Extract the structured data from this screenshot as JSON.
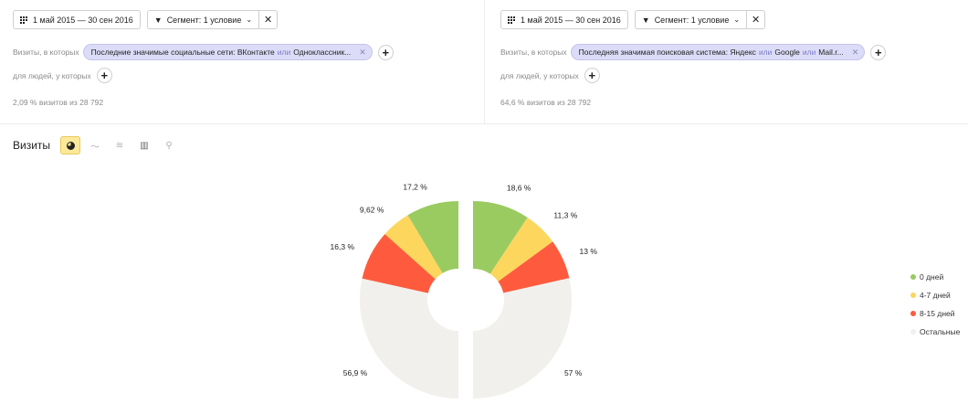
{
  "left": {
    "date_range": "1 май 2015 — 30 сен 2016",
    "segment_label": "Сегмент: 1 условие",
    "visits_label": "Визиты, в которых",
    "chip_text": "Последние значимые социальные сети: ВКонтакте",
    "chip_or": "или",
    "chip_text2": "Одноклассник...",
    "people_label": "для людей, у которых",
    "stat": "2,09 % визитов из 28 792"
  },
  "right": {
    "date_range": "1 май 2015 — 30 сен 2016",
    "segment_label": "Сегмент: 1 условие",
    "visits_label": "Визиты, в которых",
    "chip_text": "Последняя значимая поисковая система: Яндекс",
    "chip_or": "или",
    "chip_text2": "Google",
    "chip_or2": "или",
    "chip_text3": "Mail.r...",
    "people_label": "для людей, у которых",
    "stat": "64,6 % визитов из 28 792"
  },
  "section_title": "Визиты",
  "view_tabs": [
    "pie-chart-icon",
    "line-chart-icon",
    "area-chart-icon",
    "bar-chart-icon",
    "map-icon"
  ],
  "chart_data": {
    "type": "pie",
    "categories": [
      "0 дней",
      "4-7 дней",
      "8-15 дней",
      "Остальные"
    ],
    "colors": [
      "#9acb61",
      "#fcd65d",
      "#fe5b3e",
      "#f1f0ec"
    ],
    "series": [
      {
        "values": [
          17.2,
          9.62,
          16.3,
          56.9
        ],
        "labels": [
          "17,2 %",
          "9,62 %",
          "16,3 %",
          "56,9 %"
        ]
      },
      {
        "values": [
          18.6,
          11.3,
          13,
          57
        ],
        "labels": [
          "18,6 %",
          "11,3 %",
          "13 %",
          "57 %"
        ]
      }
    ],
    "legend_position": "right"
  }
}
